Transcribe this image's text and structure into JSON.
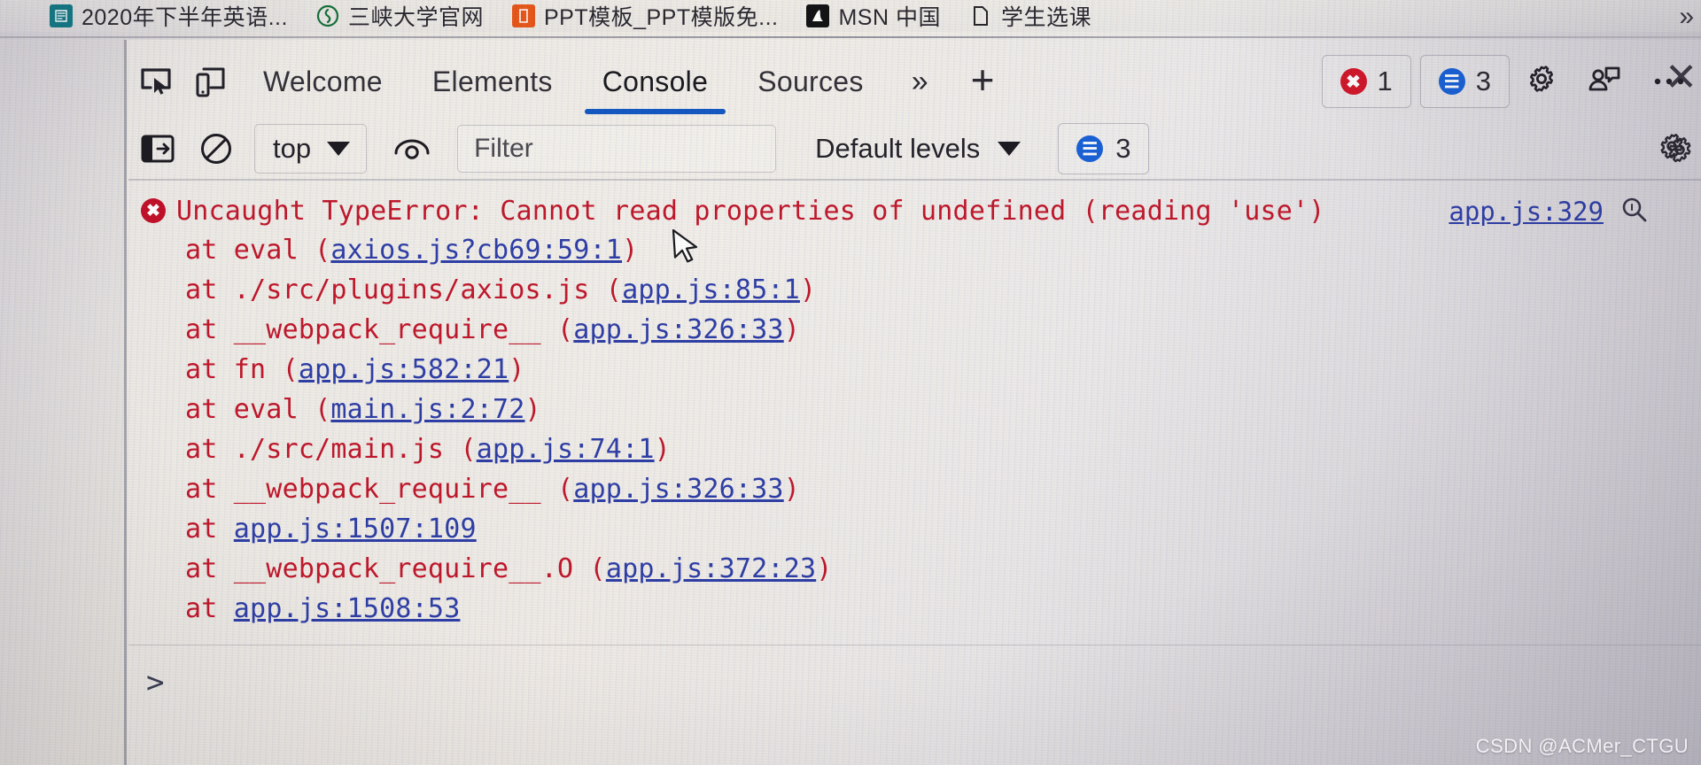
{
  "bookmarks": {
    "items": [
      {
        "label": "2020年下半年英语...",
        "icon": "document-icon"
      },
      {
        "label": "三峡大学官网",
        "icon": "university-icon"
      },
      {
        "label": "PPT模板_PPT模版免...",
        "icon": "ppt-icon"
      },
      {
        "label": "MSN 中国",
        "icon": "msn-icon"
      },
      {
        "label": "学生选课",
        "icon": "page-icon"
      }
    ],
    "overflow_label": "»"
  },
  "devtools": {
    "tabs": [
      {
        "label": "Welcome",
        "active": false
      },
      {
        "label": "Elements",
        "active": false
      },
      {
        "label": "Console",
        "active": true
      },
      {
        "label": "Sources",
        "active": false
      }
    ],
    "tab_overflow_label": "»",
    "add_tab_label": "+",
    "inspect_icon": "inspect-element-icon",
    "device_icon": "device-toolbar-icon",
    "error_count": "1",
    "message_count": "3",
    "settings_icon": "gear-icon",
    "feedback_icon": "feedback-icon",
    "more_icon": "more-options-icon",
    "close_icon": "close-icon"
  },
  "console_toolbar": {
    "sidebar_toggle_icon": "console-sidebar-icon",
    "clear_icon": "clear-console-icon",
    "context": "top",
    "eye_icon": "live-expression-icon",
    "filter_placeholder": "Filter",
    "filter_value": "",
    "levels": "Default levels",
    "message_count": "3",
    "settings_icon": "gear-icon"
  },
  "console": {
    "error": {
      "level_icon": "error-icon",
      "message": "Uncaught TypeError: Cannot read properties of undefined (reading 'use')",
      "source_link": "app.js:329",
      "source_search_icon": "search-in-sources-icon",
      "stack": [
        {
          "prefix": "at eval (",
          "link": "axios.js?cb69:59:1",
          "suffix": ")"
        },
        {
          "prefix": "at ./src/plugins/axios.js (",
          "link": "app.js:85:1",
          "suffix": ")"
        },
        {
          "prefix": "at __webpack_require__ (",
          "link": "app.js:326:33",
          "suffix": ")"
        },
        {
          "prefix": "at fn (",
          "link": "app.js:582:21",
          "suffix": ")"
        },
        {
          "prefix": "at eval (",
          "link": "main.js:2:72",
          "suffix": ")"
        },
        {
          "prefix": "at ./src/main.js (",
          "link": "app.js:74:1",
          "suffix": ")"
        },
        {
          "prefix": "at __webpack_require__ (",
          "link": "app.js:326:33",
          "suffix": ")"
        },
        {
          "prefix": "at ",
          "link": "app.js:1507:109",
          "suffix": ""
        },
        {
          "prefix": "at __webpack_require__.O (",
          "link": "app.js:372:23",
          "suffix": ")"
        },
        {
          "prefix": "at ",
          "link": "app.js:1508:53",
          "suffix": ""
        }
      ]
    },
    "prompt_caret": ">",
    "prompt_value": ""
  },
  "watermark": "CSDN @ACMer_CTGU",
  "colors": {
    "error_red": "#c2182c",
    "link_blue": "#2f3fa8",
    "active_tab_underline": "#1459c4",
    "error_badge": "#d3182b",
    "message_badge": "#1a62d8"
  }
}
